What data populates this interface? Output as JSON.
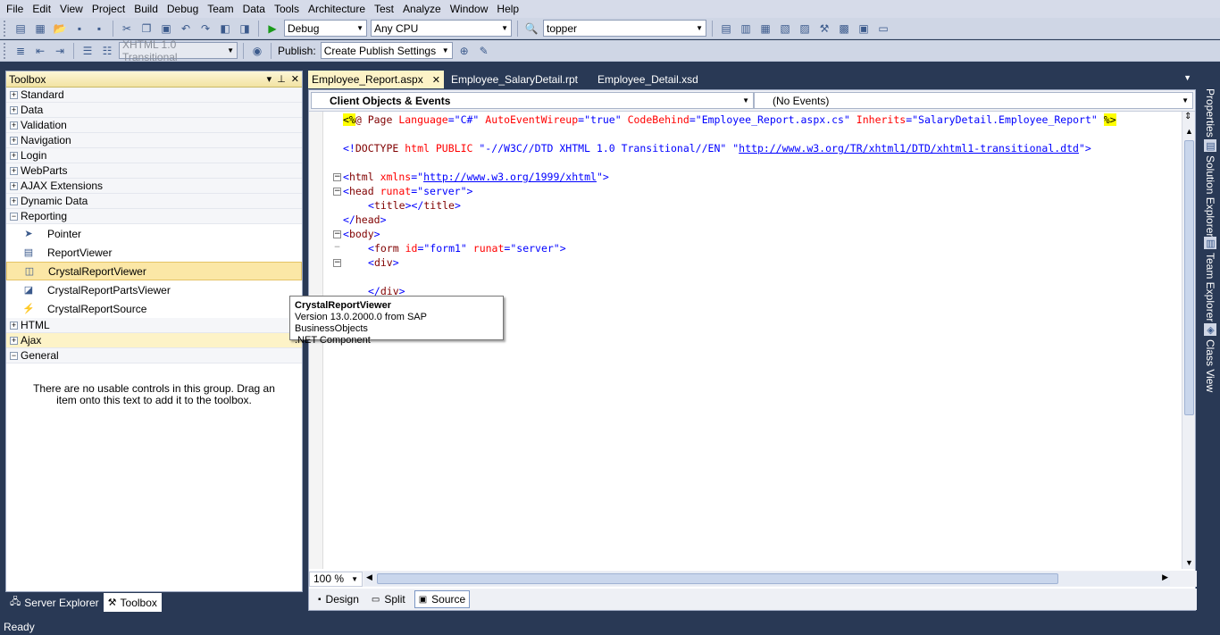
{
  "menu": [
    "File",
    "Edit",
    "View",
    "Project",
    "Build",
    "Debug",
    "Team",
    "Data",
    "Tools",
    "Architecture",
    "Test",
    "Analyze",
    "Window",
    "Help"
  ],
  "toolbar1": {
    "config": "Debug",
    "platform": "Any CPU",
    "find": "topper"
  },
  "toolbar2": {
    "doctype": "XHTML 1.0 Transitional",
    "publish_label": "Publish:",
    "publish_setting": "Create Publish Settings"
  },
  "toolbox": {
    "title": "Toolbox",
    "categories": [
      "Standard",
      "Data",
      "Validation",
      "Navigation",
      "Login",
      "WebParts",
      "AJAX Extensions",
      "Dynamic Data",
      "Reporting"
    ],
    "items": [
      "Pointer",
      "ReportViewer",
      "CrystalReportViewer",
      "CrystalReportPartsViewer",
      "CrystalReportSource"
    ],
    "categories2": [
      "HTML",
      "Ajax",
      "General"
    ],
    "empty_text": "There are no usable controls in this group. Drag an item onto this text to add it to the toolbox.",
    "tabs": [
      "Server Explorer",
      "Toolbox"
    ]
  },
  "doc_tabs": [
    "Employee_Report.aspx",
    "Employee_SalaryDetail.rpt",
    "Employee_Detail.xsd"
  ],
  "nav": {
    "objects": "Client Objects & Events",
    "events": "(No Events)"
  },
  "code": {
    "l1": {
      "p1": "<%",
      "p2": "@ Page ",
      "p3": "Language",
      "p4": "=",
      "p5": "\"C#\"",
      "p6": "AutoEventWireup",
      "p7": "\"true\"",
      "p8": "CodeBehind",
      "p9": "\"Employee_Report.aspx.cs\"",
      "p10": "Inherits",
      "p11": "\"SalaryDetail.Employee_Report\"",
      "p12": "%>"
    },
    "l2": {
      "p1": "<!",
      "p2": "DOCTYPE",
      "p3": " html PUBLIC ",
      "p4": "\"-//W3C//DTD XHTML 1.0 Transitional//EN\"",
      "p5": "\"",
      "p6": "http://www.w3.org/TR/xhtml1/DTD/xhtml1-transitional.dtd",
      "p7": "\">"
    },
    "l3": {
      "p1": "<",
      "p2": "html",
      "p3": "xmlns",
      "p4": "=\"",
      "p5": "http://www.w3.org/1999/xhtml",
      "p6": "\">"
    },
    "l4": {
      "p1": "<",
      "p2": "head",
      "p3": "runat",
      "p4": "=",
      "p5": "\"server\"",
      "p6": ">"
    },
    "l5": {
      "p1": "<",
      "p2": "title",
      "p3": "></",
      "p4": "title",
      "p5": ">"
    },
    "l6": {
      "p1": "</",
      "p2": "head",
      "p3": ">"
    },
    "l7": {
      "p1": "<",
      "p2": "body",
      "p3": ">"
    },
    "l8": {
      "p1": "<",
      "p2": "form",
      "p3": "id",
      "p4": "=",
      "p5": "\"form1\"",
      "p6": "runat",
      "p7": "=",
      "p8": "\"server\"",
      "p9": ">"
    },
    "l9": {
      "p1": "<",
      "p2": "div",
      "p3": ">"
    },
    "l10": {
      "p1": "</",
      "p2": "div",
      "p3": ">"
    }
  },
  "zoom": "100 %",
  "views": [
    "Design",
    "Split",
    "Source"
  ],
  "tooltip": {
    "title": "CrystalReportViewer",
    "line1": "Version 13.0.2000.0 from SAP BusinessObjects",
    "line2": ".NET Component"
  },
  "side_tabs": [
    "Properties",
    "Solution Explorer",
    "Team Explorer",
    "Class View"
  ],
  "status": "Ready"
}
